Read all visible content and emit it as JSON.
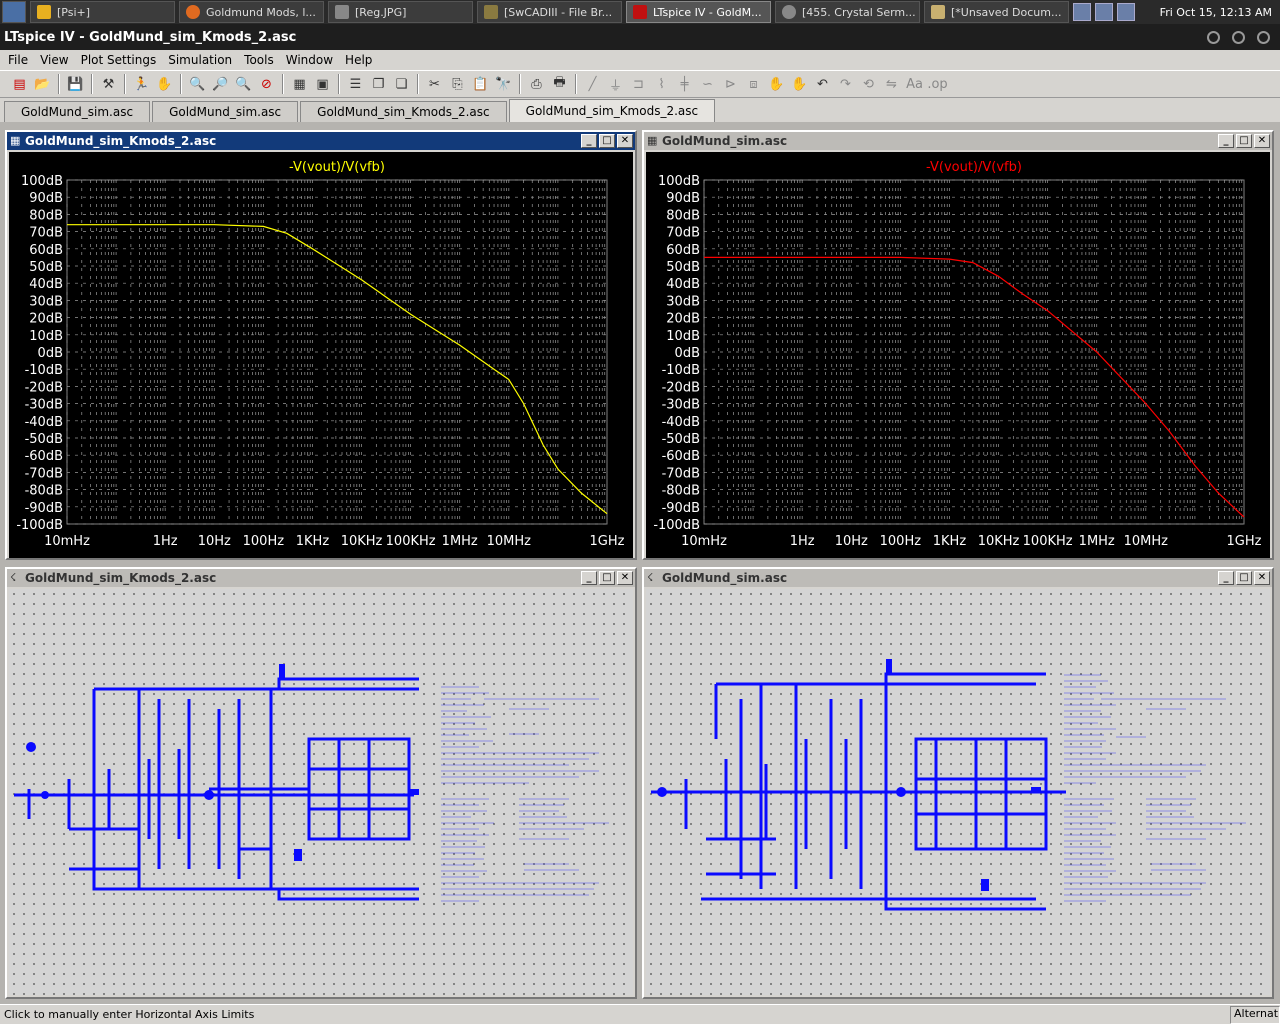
{
  "taskbar": {
    "items": [
      {
        "label": "[Psi+]",
        "icon": "star-icon"
      },
      {
        "label": "Goldmund Mods, l...",
        "icon": "firefox-icon"
      },
      {
        "label": "[Reg.JPG]",
        "icon": "image-icon"
      },
      {
        "label": "[SwCADIII - File Br...",
        "icon": "folder-icon"
      },
      {
        "label": "LTspice IV - GoldM...",
        "icon": "ltspice-icon"
      },
      {
        "label": "[455. Crystal Serm...",
        "icon": "circle-icon"
      },
      {
        "label": "[*Unsaved Docum...",
        "icon": "editor-icon"
      }
    ],
    "clock": "Fri Oct 15, 12:13 AM"
  },
  "app": {
    "title": "LTspice IV - GoldMund_sim_Kmods_2.asc"
  },
  "menu": [
    "File",
    "View",
    "Plot Settings",
    "Simulation",
    "Tools",
    "Window",
    "Help"
  ],
  "tabs": [
    {
      "label": "GoldMund_sim.asc"
    },
    {
      "label": "GoldMund_sim.asc"
    },
    {
      "label": "GoldMund_sim_Kmods_2.asc"
    },
    {
      "label": "GoldMund_sim_Kmods_2.asc"
    }
  ],
  "windows": {
    "plot_left": {
      "title": "GoldMund_sim_Kmods_2.asc",
      "trace_label": "-V(vout)/V(vfb)",
      "trace_color": "#ffff00"
    },
    "plot_right": {
      "title": "GoldMund_sim.asc",
      "trace_label": "-V(vout)/V(vfb)",
      "trace_color": "#ff0000"
    },
    "sch_left": {
      "title": "GoldMund_sim_Kmods_2.asc"
    },
    "sch_right": {
      "title": "GoldMund_sim.asc"
    }
  },
  "chart_data": [
    {
      "type": "line",
      "x_scale": "log",
      "ylim_db": [
        -100,
        100
      ],
      "y_ticks": [
        "100dB",
        "90dB",
        "80dB",
        "70dB",
        "60dB",
        "50dB",
        "40dB",
        "30dB",
        "20dB",
        "10dB",
        "0dB",
        "-10dB",
        "-20dB",
        "-30dB",
        "-40dB",
        "-50dB",
        "-60dB",
        "-70dB",
        "-80dB",
        "-90dB",
        "-100dB"
      ],
      "x_ticks": [
        "10mHz",
        "1Hz",
        "10Hz",
        "100Hz",
        "1KHz",
        "10KHz",
        "100KHz",
        "1MHz",
        "10MHz",
        "1GHz"
      ],
      "x_tick_hz": [
        0.01,
        1,
        10,
        100,
        1000,
        10000,
        100000,
        1000000,
        10000000,
        1000000000
      ],
      "xlim_hz": [
        0.01,
        1000000000
      ],
      "series": [
        {
          "name": "-V(vout)/V(vfb)",
          "color": "#ffff00",
          "x": [
            0.01,
            1,
            10,
            100,
            300,
            1000,
            10000,
            100000,
            1000000,
            5000000,
            10000000,
            20000000,
            50000000,
            100000000,
            300000000,
            1000000000
          ],
          "y": [
            74,
            74,
            74,
            73,
            69,
            60,
            42,
            22,
            4,
            -10,
            -16,
            -30,
            -54,
            -68,
            -82,
            -94
          ]
        }
      ]
    },
    {
      "type": "line",
      "x_scale": "log",
      "ylim_db": [
        -100,
        100
      ],
      "y_ticks": [
        "100dB",
        "90dB",
        "80dB",
        "70dB",
        "60dB",
        "50dB",
        "40dB",
        "30dB",
        "20dB",
        "10dB",
        "0dB",
        "-10dB",
        "-20dB",
        "-30dB",
        "-40dB",
        "-50dB",
        "-60dB",
        "-70dB",
        "-80dB",
        "-90dB",
        "-100dB"
      ],
      "x_ticks": [
        "10mHz",
        "1Hz",
        "10Hz",
        "100Hz",
        "1KHz",
        "10KHz",
        "100KHz",
        "1MHz",
        "10MHz",
        "1GHz"
      ],
      "x_tick_hz": [
        0.01,
        1,
        10,
        100,
        1000,
        10000,
        100000,
        1000000,
        10000000,
        1000000000
      ],
      "xlim_hz": [
        0.01,
        1000000000
      ],
      "series": [
        {
          "name": "-V(vout)/V(vfb)",
          "color": "#ff0000",
          "x": [
            0.01,
            1,
            100,
            1000,
            3000,
            10000,
            30000,
            100000,
            1000000,
            10000000,
            30000000,
            100000000,
            300000000,
            1000000000
          ],
          "y": [
            55,
            55,
            55,
            54,
            52,
            44,
            34,
            24,
            0,
            -30,
            -46,
            -66,
            -82,
            -96
          ]
        }
      ]
    }
  ],
  "status": {
    "text": "Click to manually enter Horizontal Axis Limits",
    "right": "Alternat"
  }
}
